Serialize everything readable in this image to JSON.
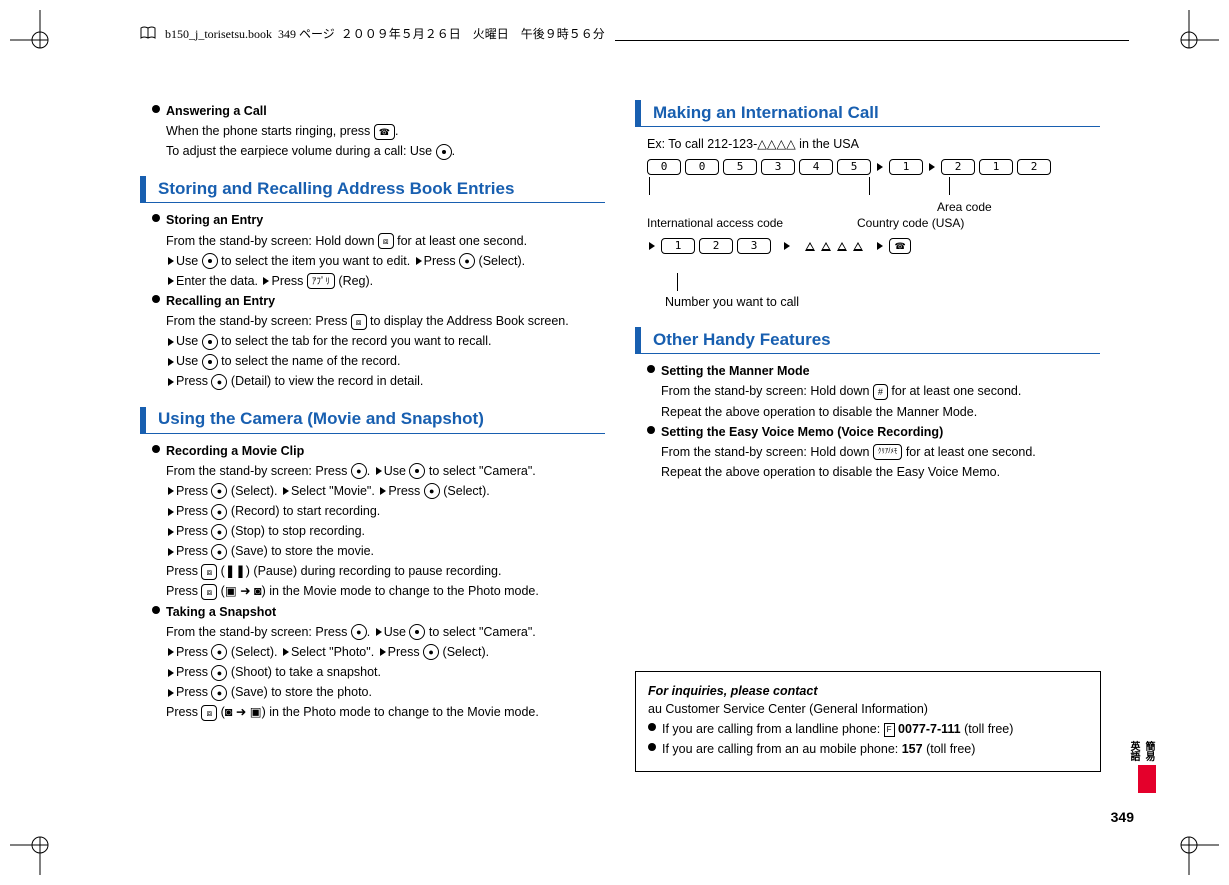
{
  "header": {
    "filename": "b150_j_torisetsu.book",
    "page_info": "349 ページ",
    "date": "２００９年５月２６日　火曜日　午後９時５６分"
  },
  "col1": {
    "answering": {
      "title": "Answering a Call",
      "line1a": "When the phone starts ringing, press ",
      "line1b": ".",
      "line2a": "To adjust the earpiece volume during a call: Use ",
      "line2b": "."
    },
    "section_storing_title": "Storing and Recalling Address Book Entries",
    "storing": {
      "title": "Storing an Entry",
      "l1a": "From the stand-by screen: Hold down ",
      "l1b": " for at least one second.",
      "l2a": "Use ",
      "l2b": " to select the item you want to edit. ",
      "l2c": "Press ",
      "l2d": " (Select).",
      "l3a": "Enter the data. ",
      "l3b": "Press ",
      "l3c": " (Reg)."
    },
    "recalling": {
      "title": "Recalling an Entry",
      "l1a": "From the stand-by screen: Press ",
      "l1b": " to display the Address Book screen.",
      "l2a": "Use ",
      "l2b": " to select the tab for the record you want to recall.",
      "l3a": "Use ",
      "l3b": " to select the name of the record.",
      "l4a": "Press ",
      "l4b": " (Detail) to view the record in detail."
    },
    "section_camera_title": "Using the Camera (Movie and Snapshot)",
    "movie": {
      "title": "Recording a Movie Clip",
      "l1a": "From the stand-by screen: Press ",
      "l1b": ". ",
      "l1c": "Use ",
      "l1d": " to select \"Camera\".",
      "l2a": "Press ",
      "l2b": " (Select). ",
      "l2c": "Select \"Movie\". ",
      "l2d": "Press ",
      "l2e": " (Select).",
      "l3a": "Press ",
      "l3b": " (Record) to start recording.",
      "l4a": "Press ",
      "l4b": " (Stop) to stop recording.",
      "l5a": "Press ",
      "l5b": " (Save) to store the movie.",
      "l6a": "Press ",
      "l6b": " (",
      "l6c": ") (Pause) during recording to pause recording.",
      "l7a": "Press ",
      "l7b": " (",
      "l7c": ") in the Movie mode to change to the Photo mode."
    },
    "snapshot": {
      "title": "Taking a Snapshot",
      "l1a": "From the stand-by screen: Press ",
      "l1b": ". ",
      "l1c": "Use ",
      "l1d": " to select \"Camera\".",
      "l2a": "Press ",
      "l2b": " (Select). ",
      "l2c": "Select \"Photo\". ",
      "l2d": "Press ",
      "l2e": " (Select).",
      "l3a": "Press ",
      "l3b": " (Shoot) to take a snapshot.",
      "l4a": "Press ",
      "l4b": " (Save) to store the photo.",
      "l5a": "Press ",
      "l5b": " (",
      "l5c": ") in the Photo mode to change to the Movie mode."
    }
  },
  "col2": {
    "section_intl_title": "Making an International Call",
    "intl": {
      "example_label": "Ex: To call 212-123-△△△△ in the USA",
      "digits_row1": [
        "0",
        "0",
        "5",
        "3",
        "4",
        "5",
        "1",
        "2",
        "1",
        "2"
      ],
      "intl_access_label": "International access code",
      "area_code_label": "Area code",
      "country_code_label": "Country code (USA)",
      "digits_row2": [
        "1",
        "2",
        "3"
      ],
      "number_label": "Number you want to call"
    },
    "section_other_title": "Other Handy Features",
    "manner": {
      "title": "Setting the Manner Mode",
      "l1a": "From the stand-by screen: Hold down ",
      "l1b": " for at least one second.",
      "l2": "Repeat the above operation to disable the Manner Mode."
    },
    "voice": {
      "title": "Setting the Easy Voice Memo (Voice Recording)",
      "l1a": "From the stand-by screen: Hold down ",
      "l1b": " for at least one second.",
      "l2": "Repeat the above operation to disable the Easy Voice Memo."
    },
    "contact": {
      "title": "For inquiries, please contact",
      "center": "au Customer Service Center (General Information)",
      "landline_a": "If you are calling from a landline phone: ",
      "landline_num": "0077-7-111",
      "landline_b": " (toll free)",
      "mobile_a": "If you are calling from an au mobile phone: ",
      "mobile_num": "157",
      "mobile_b": " (toll free)"
    }
  },
  "side_tab_text": "簡易英語",
  "page_number": "349",
  "keys": {
    "call": "☎",
    "addr": "⧈",
    "app": "ｱﾌﾟﾘ",
    "clear": "ｸﾘｱ/ﾒﾓ",
    "hash": "#",
    "pause": "❚❚",
    "cam": "◙",
    "vid": "▣"
  }
}
